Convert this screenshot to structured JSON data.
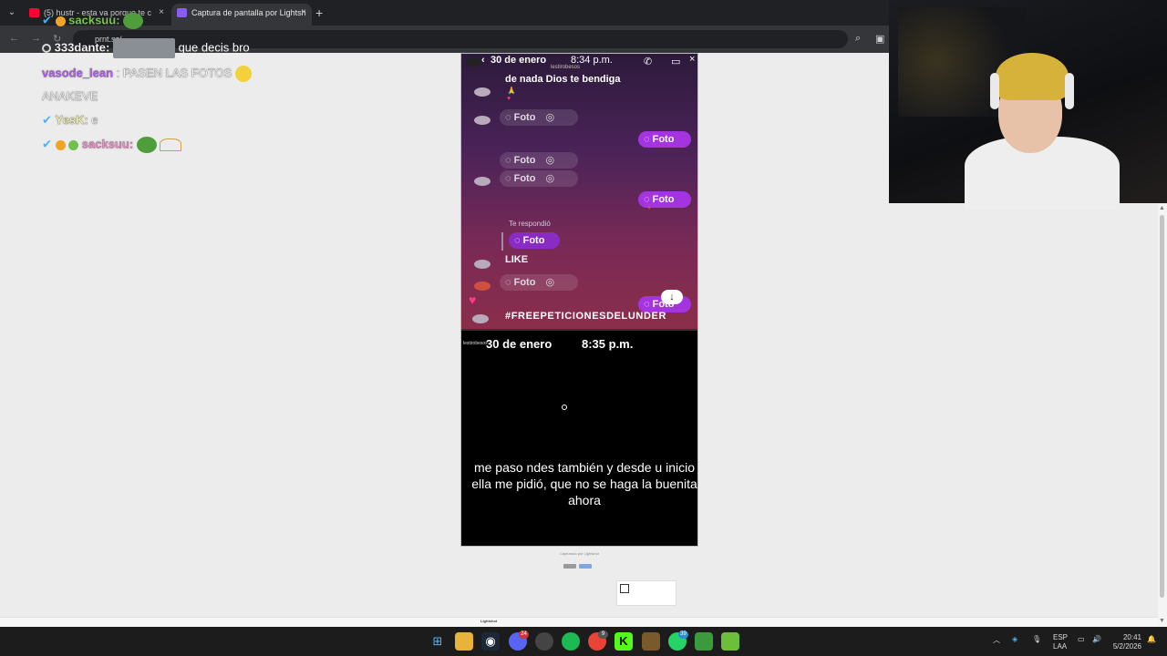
{
  "browser": {
    "tabs": [
      {
        "title": "(5) hustr - esta va porque te c",
        "active": false
      },
      {
        "title": "Captura de pantalla por Lightsh",
        "active": true
      }
    ],
    "url": "prnt.sc/"
  },
  "chat": [
    {
      "user": "sacksuu:",
      "message": "",
      "user_color": "#7ad14e"
    },
    {
      "user": "333dante:",
      "message": "que decis bro",
      "user_color": "#ffffff"
    },
    {
      "user": "vasode_lean",
      "message": ": PASEN LAS FOTOS",
      "user_color": "#b45cf0"
    },
    {
      "user": "ANAKEVE",
      "message": "",
      "user_color": "#ffffff"
    },
    {
      "user": "YesK:",
      "message": "e",
      "user_color": "#f4f4aa"
    },
    {
      "user": "sacksuu:",
      "message": "",
      "user_color": "#f08acb"
    }
  ],
  "screenshot": {
    "dm_header_date": "30 de enero",
    "dm_header_time": "8:34 p.m.",
    "dm_username": "lestirobesos",
    "message_first": "de nada Dios te bendiga",
    "photo_label": "Foto",
    "reply_label": "Te respondió",
    "like_text": "LIKE",
    "hashtag": "#FREEPETICIONESDELUNDER",
    "story_date": "30 de enero",
    "story_time": "8:35 p.m.",
    "story_caption": "me paso ndes también y desde u inicio ella me pidió, que no se haga la buenita ahora"
  },
  "lightshot": {
    "captured_by": "Capturado por Lightshot",
    "footer_brand": "Lightshot"
  },
  "taskbar": {
    "lang_top": "ESP",
    "lang_bottom": "LAA",
    "time": "20:41",
    "date": "5/2/2026",
    "badges": {
      "discord": "24",
      "chrome": "9",
      "whatsapp": "39"
    }
  },
  "colors": {
    "dm_purple": "#a433e0",
    "chat_green": "#7ad14e",
    "chat_purple": "#b45cf0"
  }
}
